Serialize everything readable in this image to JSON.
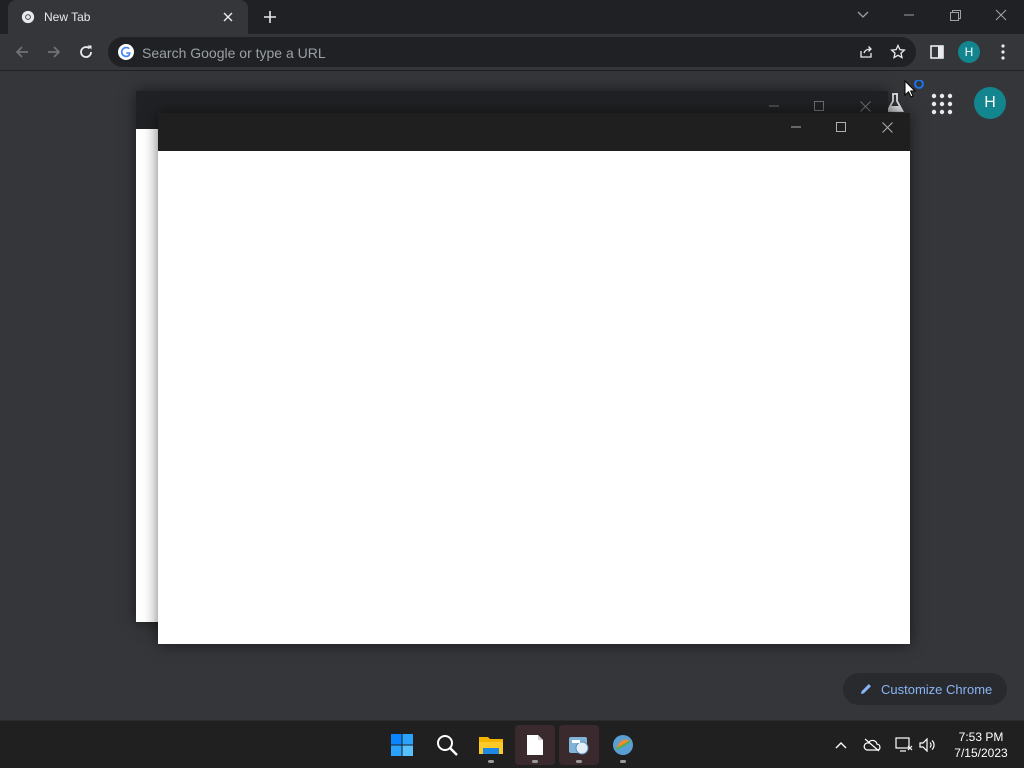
{
  "browser": {
    "tab": {
      "title": "New Tab"
    },
    "omnibox": {
      "placeholder": "Search Google or type a URL"
    },
    "profile_initial": "H"
  },
  "ntp": {
    "profile_initial": "H",
    "customize_label": "Customize Chrome"
  },
  "taskbar": {
    "clock_time": "7:53 PM",
    "clock_date": "7/15/2023"
  },
  "colors": {
    "accent_link": "#8ab4f8",
    "avatar": "#12858e",
    "background": "#35363a",
    "frame": "#202124"
  }
}
